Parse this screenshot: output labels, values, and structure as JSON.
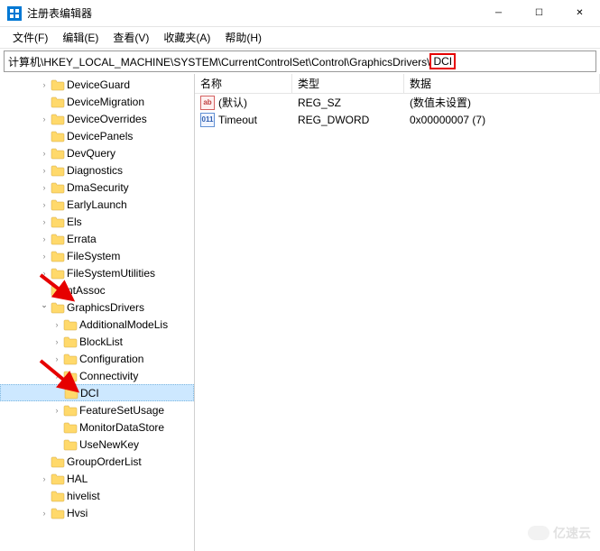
{
  "window": {
    "title": "注册表编辑器"
  },
  "menu": {
    "file": "文件(F)",
    "edit": "编辑(E)",
    "view": "查看(V)",
    "favorites": "收藏夹(A)",
    "help": "帮助(H)"
  },
  "address": {
    "path_prefix": "计算机\\HKEY_LOCAL_MACHINE\\SYSTEM\\CurrentControlSet\\Control\\GraphicsDrivers\\",
    "path_highlight": "DCI"
  },
  "tree": [
    {
      "label": "DeviceGuard",
      "depth": 3,
      "exp": ">"
    },
    {
      "label": "DeviceMigration",
      "depth": 3,
      "exp": ""
    },
    {
      "label": "DeviceOverrides",
      "depth": 3,
      "exp": ">"
    },
    {
      "label": "DevicePanels",
      "depth": 3,
      "exp": ""
    },
    {
      "label": "DevQuery",
      "depth": 3,
      "exp": ">"
    },
    {
      "label": "Diagnostics",
      "depth": 3,
      "exp": ">"
    },
    {
      "label": "DmaSecurity",
      "depth": 3,
      "exp": ">"
    },
    {
      "label": "EarlyLaunch",
      "depth": 3,
      "exp": ">"
    },
    {
      "label": "Els",
      "depth": 3,
      "exp": ">"
    },
    {
      "label": "Errata",
      "depth": 3,
      "exp": ">"
    },
    {
      "label": "FileSystem",
      "depth": 3,
      "exp": ">"
    },
    {
      "label": "FileSystemUtilities",
      "depth": 3,
      "exp": ">"
    },
    {
      "label": "ntAssoc",
      "depth": 3,
      "exp": ""
    },
    {
      "label": "GraphicsDrivers",
      "depth": 3,
      "exp": "v"
    },
    {
      "label": "AdditionalModeLis",
      "depth": 4,
      "exp": ">"
    },
    {
      "label": "BlockList",
      "depth": 4,
      "exp": ">"
    },
    {
      "label": "Configuration",
      "depth": 4,
      "exp": ">"
    },
    {
      "label": "Connectivity",
      "depth": 4,
      "exp": ">"
    },
    {
      "label": "DCI",
      "depth": 4,
      "exp": "",
      "selected": true
    },
    {
      "label": "FeatureSetUsage",
      "depth": 4,
      "exp": ">"
    },
    {
      "label": "MonitorDataStore",
      "depth": 4,
      "exp": ""
    },
    {
      "label": "UseNewKey",
      "depth": 4,
      "exp": ""
    },
    {
      "label": "GroupOrderList",
      "depth": 3,
      "exp": ""
    },
    {
      "label": "HAL",
      "depth": 3,
      "exp": ">"
    },
    {
      "label": "hivelist",
      "depth": 3,
      "exp": ""
    },
    {
      "label": "Hvsi",
      "depth": 3,
      "exp": ">"
    }
  ],
  "columns": {
    "name": "名称",
    "type": "类型",
    "data": "数据"
  },
  "values": [
    {
      "icon": "sz",
      "icon_text": "ab",
      "name": "(默认)",
      "type": "REG_SZ",
      "data": "(数值未设置)"
    },
    {
      "icon": "dw",
      "icon_text": "011",
      "name": "Timeout",
      "type": "REG_DWORD",
      "data": "0x00000007 (7)"
    }
  ],
  "watermark": "亿速云"
}
